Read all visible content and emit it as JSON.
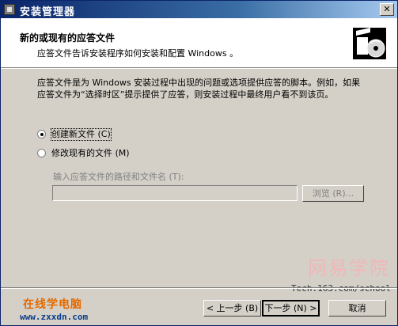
{
  "window": {
    "title": "安装管理器",
    "close_glyph": "✕"
  },
  "header": {
    "title": "新的或现有的应答文件",
    "subtitle": "应答文件告诉安装程序如何安装和配置 Windows 。"
  },
  "body": {
    "description": "应答文件是为 Windows 安装过程中出现的问题或选项提供应答的脚本。例如，如果应答文件为“选择时区”提示提供了应答，则安装过程中最终用户看不到该页。",
    "options": [
      {
        "label": "创建新文件 (C)",
        "checked": true
      },
      {
        "label": "修改现有的文件 (M)",
        "checked": false
      }
    ],
    "path_label": "输入应答文件的路径和文件名 (T):",
    "path_value": "",
    "browse_label": "浏览 (R)..."
  },
  "buttons": {
    "back": "< 上一步 (B)",
    "next": "下一步 (N) >",
    "cancel": "取消"
  },
  "watermark": {
    "site_name": "网易学院",
    "site_url": "Tech.163.com/school",
    "brand_name": "在线学电脑",
    "brand_url": "www.zxxdn.com"
  },
  "colors": {
    "titlebar_start": "#0a246a",
    "titlebar_end": "#a6caf0",
    "dialog_bg": "#d4d0c8",
    "brand_orange": "#e36a00"
  },
  "icons": {
    "app": "installer-icon",
    "header": "setup-box-cd-icon",
    "close": "close-icon"
  }
}
